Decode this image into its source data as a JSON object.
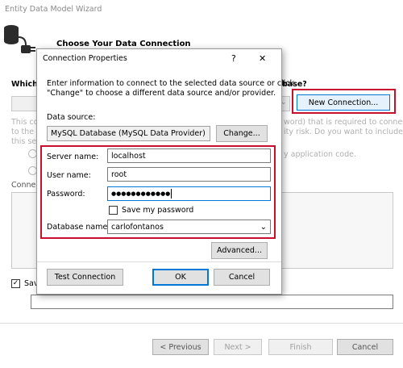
{
  "wizard": {
    "title": "Entity Data Model Wizard",
    "heading": "Choose Your Data Connection",
    "question_prefix": "Which",
    "question_suffix": "base?",
    "new_connection_label": "New Connection...",
    "info_line1_left": "This co",
    "info_line1_right": "word) that is required to connect",
    "info_line2_left": "to the",
    "info_line2_right": "ity risk. Do you want to include",
    "info_line3_left": "this se",
    "radio_option_right": "y application code.",
    "connection_label": "Conne",
    "save_label": "Sav",
    "previous_label": "< Previous",
    "next_label": "Next >",
    "finish_label": "Finish",
    "cancel_label": "Cancel"
  },
  "dialog": {
    "title": "Connection Properties",
    "help_glyph": "?",
    "close_glyph": "✕",
    "intro_line1": "Enter information to connect to the selected data source or click",
    "intro_line2": "\"Change\" to choose a different data source and/or provider.",
    "data_source_label": "Data source:",
    "data_source_value": "MySQL Database (MySQL Data Provider)",
    "change_label": "Change...",
    "server_name_label": "Server name:",
    "server_name_value": "localhost",
    "user_name_label": "User name:",
    "user_name_value": "root",
    "password_label": "Password:",
    "password_value": "●●●●●●●●●●●●",
    "save_password_label": "Save my password",
    "database_name_label": "Database name:",
    "database_name_value": "carlofontanos",
    "advanced_label": "Advanced...",
    "test_connection_label": "Test Connection",
    "ok_label": "OK",
    "cancel_label": "Cancel"
  },
  "colors": {
    "highlight": "#c8102e",
    "focus": "#0078d7"
  }
}
